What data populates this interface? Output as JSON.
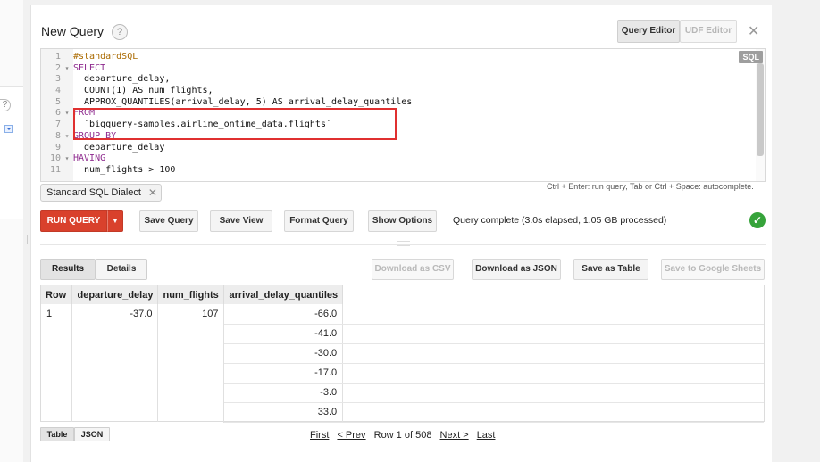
{
  "dialog": {
    "title": "New Query",
    "help": "?",
    "tabs": {
      "query_editor": "Query Editor",
      "udf_editor": "UDF Editor"
    },
    "close": "✕"
  },
  "editor": {
    "badge": "SQL",
    "lines": [
      {
        "n": "1",
        "fold": "",
        "code": "#standardSQL"
      },
      {
        "n": "2",
        "fold": "▾",
        "code": "SELECT"
      },
      {
        "n": "3",
        "fold": "",
        "code": "  departure_delay,"
      },
      {
        "n": "4",
        "fold": "",
        "code": "  COUNT(1) AS num_flights,"
      },
      {
        "n": "5",
        "fold": "",
        "code": "  APPROX_QUANTILES(arrival_delay, 5) AS arrival_delay_quantiles"
      },
      {
        "n": "6",
        "fold": "▾",
        "code": "FROM"
      },
      {
        "n": "7",
        "fold": "",
        "code": "  `bigquery-samples.airline_ontime_data.flights`"
      },
      {
        "n": "8",
        "fold": "▾",
        "code": "GROUP BY"
      },
      {
        "n": "9",
        "fold": "",
        "code": "  departure_delay"
      },
      {
        "n": "10",
        "fold": "▾",
        "code": "HAVING"
      },
      {
        "n": "11",
        "fold": "",
        "code": "  num_flights > 100"
      }
    ]
  },
  "hint": "Ctrl + Enter: run query, Tab or Ctrl + Space: autocomplete.",
  "dialect_chip": "Standard SQL Dialect",
  "toolbar": {
    "run": "RUN QUERY",
    "save_query": "Save Query",
    "save_view": "Save View",
    "format_query": "Format Query",
    "show_options": "Show Options",
    "status": "Query complete (3.0s elapsed, 1.05 GB processed)"
  },
  "results": {
    "tabs": {
      "results": "Results",
      "details": "Details"
    },
    "actions": {
      "download_csv": "Download as CSV",
      "download_json": "Download as JSON",
      "save_table": "Save as Table",
      "save_sheets": "Save to Google Sheets"
    },
    "columns": [
      "Row",
      "departure_delay",
      "num_flights",
      "arrival_delay_quantiles"
    ],
    "row": {
      "row": "1",
      "departure_delay": "-37.0",
      "num_flights": "107"
    },
    "quantiles": [
      "-66.0",
      "-41.0",
      "-30.0",
      "-17.0",
      "-3.0",
      "33.0"
    ],
    "view_toggle": {
      "table": "Table",
      "json": "JSON"
    },
    "pager": {
      "first": "First",
      "prev": "< Prev",
      "info": "Row 1 of 508",
      "next": "Next >",
      "last": "Last"
    }
  },
  "colors": {
    "run_button": "#d9412c",
    "success": "#36a33a",
    "highlight_box": "#e03030"
  }
}
